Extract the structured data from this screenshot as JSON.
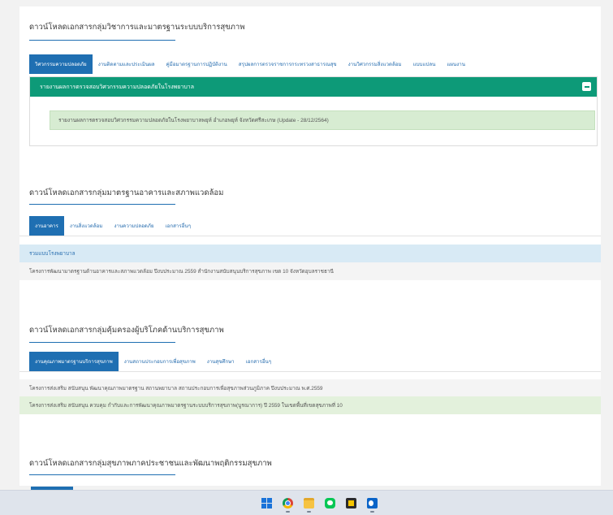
{
  "section1": {
    "title": "ดาวน์โหลดเอกสารกลุ่มวิชาการและมาตรฐานระบบบริการสุขภาพ",
    "tabs": [
      {
        "label": "วิศวกรรมความปลอดภัย",
        "active": true
      },
      {
        "label": "งานติดตามและประเมินผล",
        "active": false
      },
      {
        "label": "คู่มือมาตรฐานการปฏิบัติงาน",
        "active": false
      },
      {
        "label": "สรุปผลการตรวจราชการกระทรวงสาธารณสุข",
        "active": false
      },
      {
        "label": "งานวิศวกรรมสิ่งแวดล้อม",
        "active": false
      },
      {
        "label": "แบบแปลน",
        "active": false
      },
      {
        "label": "แผนงาน",
        "active": false
      }
    ],
    "panel_header": "รายงานผลการตรวจสอบวิศวกรรมความปลอดภัยในโรงพยาบาล",
    "panel_item": "รายงานผลการตรวจสอบวิศวกรรมความปลอดภัยในโรงพยาบาลพยุห์ อำเภอพยุห์ จังหวัดศรีสะเกษ (Update - 28/12/2564)"
  },
  "section2": {
    "title": "ดาวน์โหลดเอกสารกลุ่มมาตรฐานอาคารและสภาพแวดล้อม",
    "tabs": [
      {
        "label": "งานอาคาร",
        "active": true
      },
      {
        "label": "งานสิ่งแวดล้อม",
        "active": false
      },
      {
        "label": "งานความปลอดภัย",
        "active": false
      },
      {
        "label": "เอกสารอื่นๆ",
        "active": false
      }
    ],
    "group_header": "รวมแบบโรงพยาบาล",
    "item": "โครงการพัฒนามาตรฐานด้านอาคารและสภาพแวดล้อม ปีงบประมาณ 2559 สำนักงานสนับสนุนบริการสุขภาพ เขต 10 จังหวัดอุบลราชธานี"
  },
  "section3": {
    "title": "ดาวน์โหลดเอกสารกลุ่มคุ้มครองผู้บริโภคด้านบริการสุขภาพ",
    "tabs": [
      {
        "label": "งานคุณภาพมาตรฐานบริการสุขภาพ",
        "active": true
      },
      {
        "label": "งานสถานประกอบการเพื่อสุขภาพ",
        "active": false
      },
      {
        "label": "งานสุขศึกษา",
        "active": false
      },
      {
        "label": "เอกสารอื่นๆ",
        "active": false
      }
    ],
    "items": [
      "โครงการส่งเสริม สนับสนุน พัฒนาคุณภาพมาตรฐาน สถานพยาบาล สถานประกอบการเพื่อสุขภาพส่วนภูมิภาค ปีงบประมาณ พ.ศ.2559",
      "โครงการส่งเสริม สนับสนุน ควบคุม กำกับและการพัฒนาคุณภาพมาตรฐานระบบบริการสุขภาพ(บูรณาการ) ปี 2559 ในเขตพื้นที่เขตสุขภาพที่ 10"
    ]
  },
  "section4": {
    "title": "ดาวน์โหลดเอกสารกลุ่มสุขภาพภาคประชาชนและพัฒนาพฤติกรรมสุขภาพ"
  },
  "taskbar": {
    "icons": [
      "windows-start-icon",
      "chrome-icon",
      "file-explorer-icon",
      "line-icon",
      "sticky-notes-icon",
      "outlook-icon"
    ]
  },
  "colors": {
    "primary": "#1f6fb2",
    "panel_header": "#0d9a78",
    "green_row": "#d7ecd2",
    "blue_row": "#d8eaf5"
  }
}
